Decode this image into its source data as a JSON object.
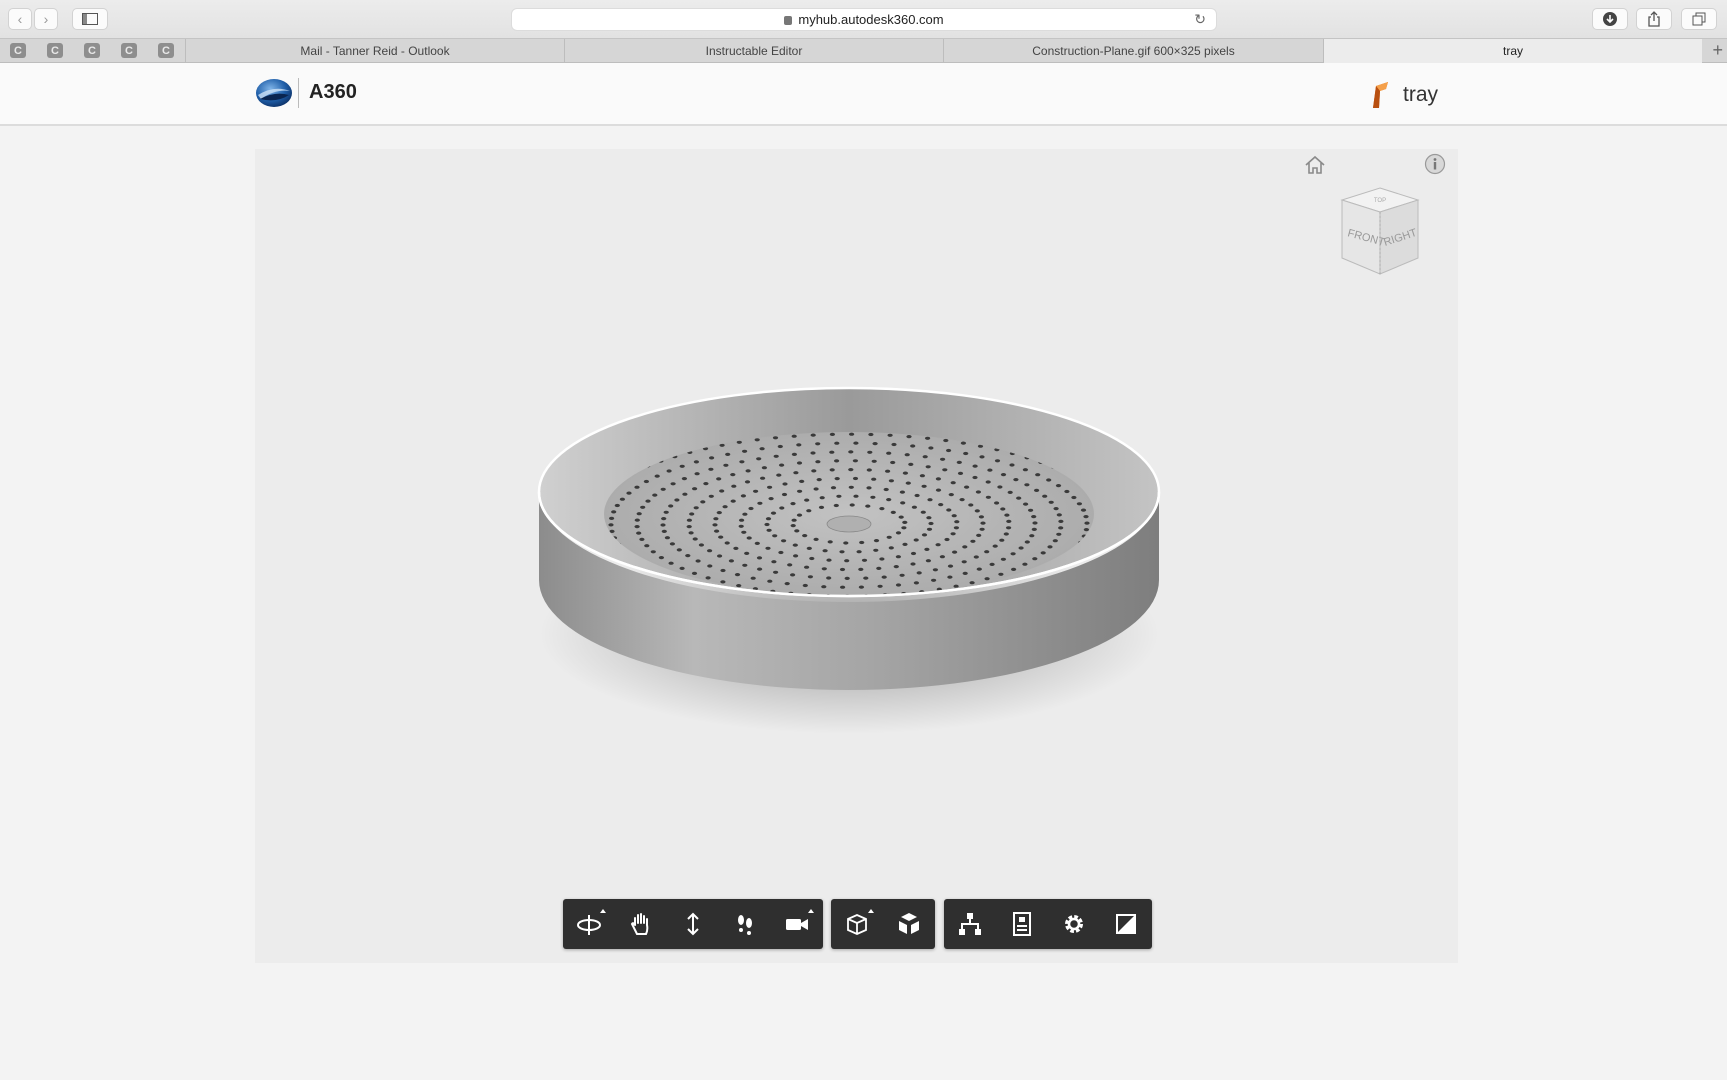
{
  "browser": {
    "url": "myhub.autodesk360.com",
    "pinned_tabs": [
      "C",
      "C",
      "C",
      "C",
      "C"
    ],
    "tabs": [
      {
        "title": "Mail - Tanner Reid - Outlook"
      },
      {
        "title": "Instructable Editor"
      },
      {
        "title": "Construction-Plane.gif 600×325 pixels"
      },
      {
        "title": "tray"
      }
    ],
    "active_tab_index": 3
  },
  "app": {
    "name": "A360",
    "document_title": "tray"
  },
  "viewer": {
    "viewcube_faces": {
      "front": "FRONT",
      "right": "RIGHT"
    },
    "toolbar_groups": [
      {
        "tools": [
          {
            "name": "orbit-tool",
            "icon": "orbit-icon",
            "has_menu": true
          },
          {
            "name": "pan-tool",
            "icon": "hand-icon",
            "has_menu": false
          },
          {
            "name": "zoom-tool",
            "icon": "zoom-arrows-icon",
            "has_menu": false
          },
          {
            "name": "walk-tool",
            "icon": "footsteps-icon",
            "has_menu": false
          },
          {
            "name": "camera-tool",
            "icon": "video-camera-icon",
            "has_menu": true
          }
        ]
      },
      {
        "tools": [
          {
            "name": "section-tool",
            "icon": "section-box-icon",
            "has_menu": true
          },
          {
            "name": "explode-tool",
            "icon": "explode-cube-icon",
            "has_menu": false
          }
        ]
      },
      {
        "tools": [
          {
            "name": "model-browser-tool",
            "icon": "hierarchy-icon",
            "has_menu": false
          },
          {
            "name": "properties-tool",
            "icon": "properties-icon",
            "has_menu": false
          },
          {
            "name": "settings-tool",
            "icon": "gear-icon",
            "has_menu": false
          },
          {
            "name": "fullscreen-tool",
            "icon": "fullscreen-icon",
            "has_menu": false
          }
        ]
      }
    ]
  },
  "colors": {
    "viewer_bg": "#ececec",
    "toolbar_bg": "#2f2f2f",
    "model_metal": "#a9a9a9"
  }
}
